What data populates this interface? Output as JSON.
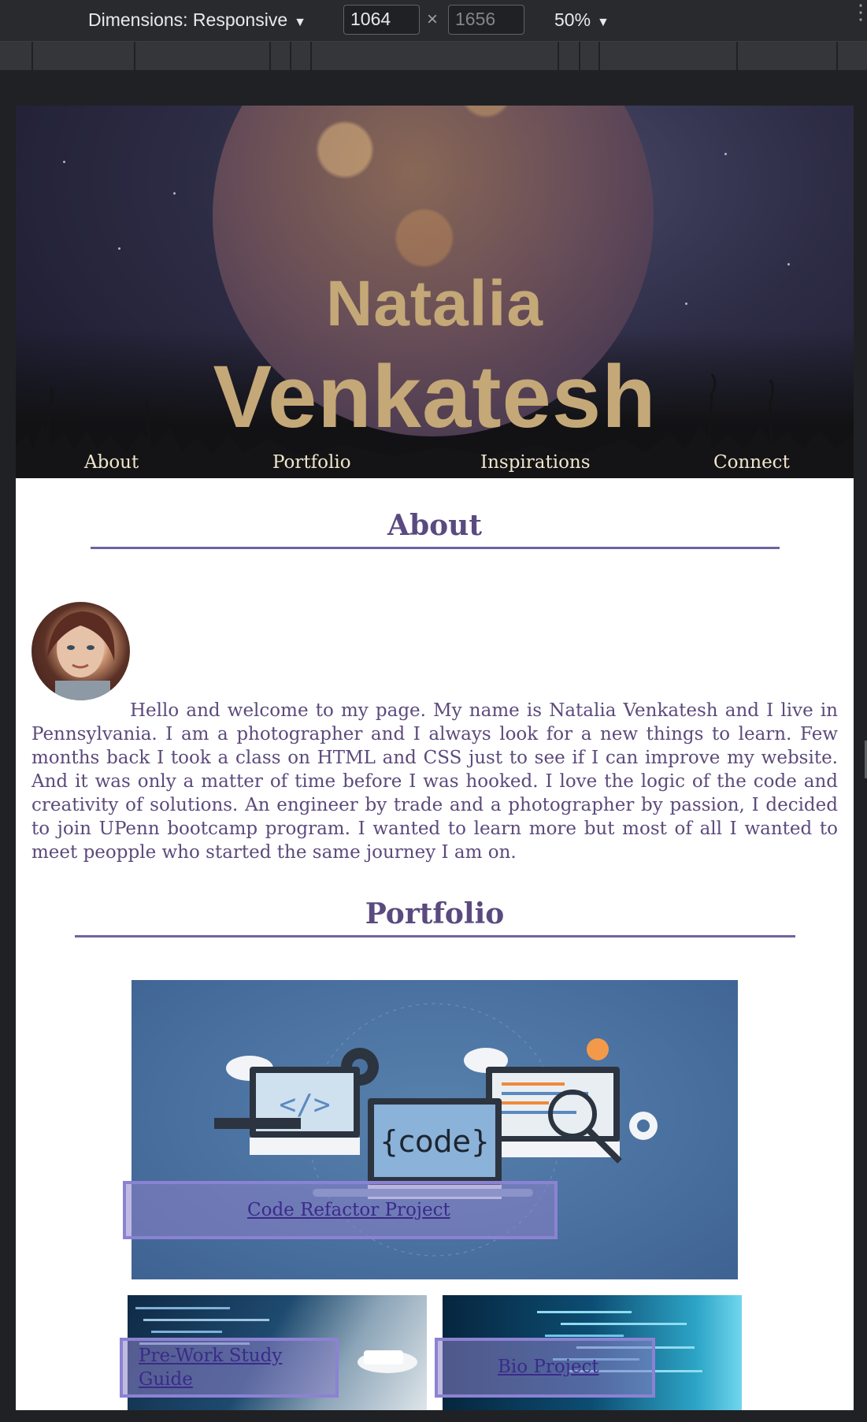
{
  "devtools": {
    "dimensions_label": "Dimensions: Responsive",
    "width_value": "1064",
    "height_placeholder": "1656",
    "times_symbol": "×",
    "zoom_label": "50%",
    "more_icon": "⋮"
  },
  "site": {
    "first_name": "Natalia",
    "last_name": "Venkatesh",
    "nav": [
      "About",
      "Portfolio",
      "Inspirations",
      "Connect"
    ]
  },
  "about": {
    "title": "About",
    "text": "Hello and welcome to my page. My name is Natalia Venkatesh and I live in Pennsylvania. I am a photographer and I always look for a new things to learn. Few months back I took a class on HTML and CSS just to see if I can improve my website. And it was only a matter of time before I was hooked. I love the logic of the code and creativity of solutions. An engineer by trade and a photographer by passion, I decided to join UPenn bootcamp program. I wanted to learn more but most of all I wanted to meet peopple who started the same journey I am on."
  },
  "portfolio": {
    "title": "Portfolio",
    "code_badge": "{code}",
    "code_tag": "</>",
    "projects": [
      {
        "label": "Code Refactor Project"
      },
      {
        "label": "Pre-Work Study Guide"
      },
      {
        "label": "Bio Project"
      }
    ]
  },
  "colors": {
    "accent": "#5a4a80",
    "hero_name": "#c4a877",
    "link_box": "#8c82d2"
  }
}
